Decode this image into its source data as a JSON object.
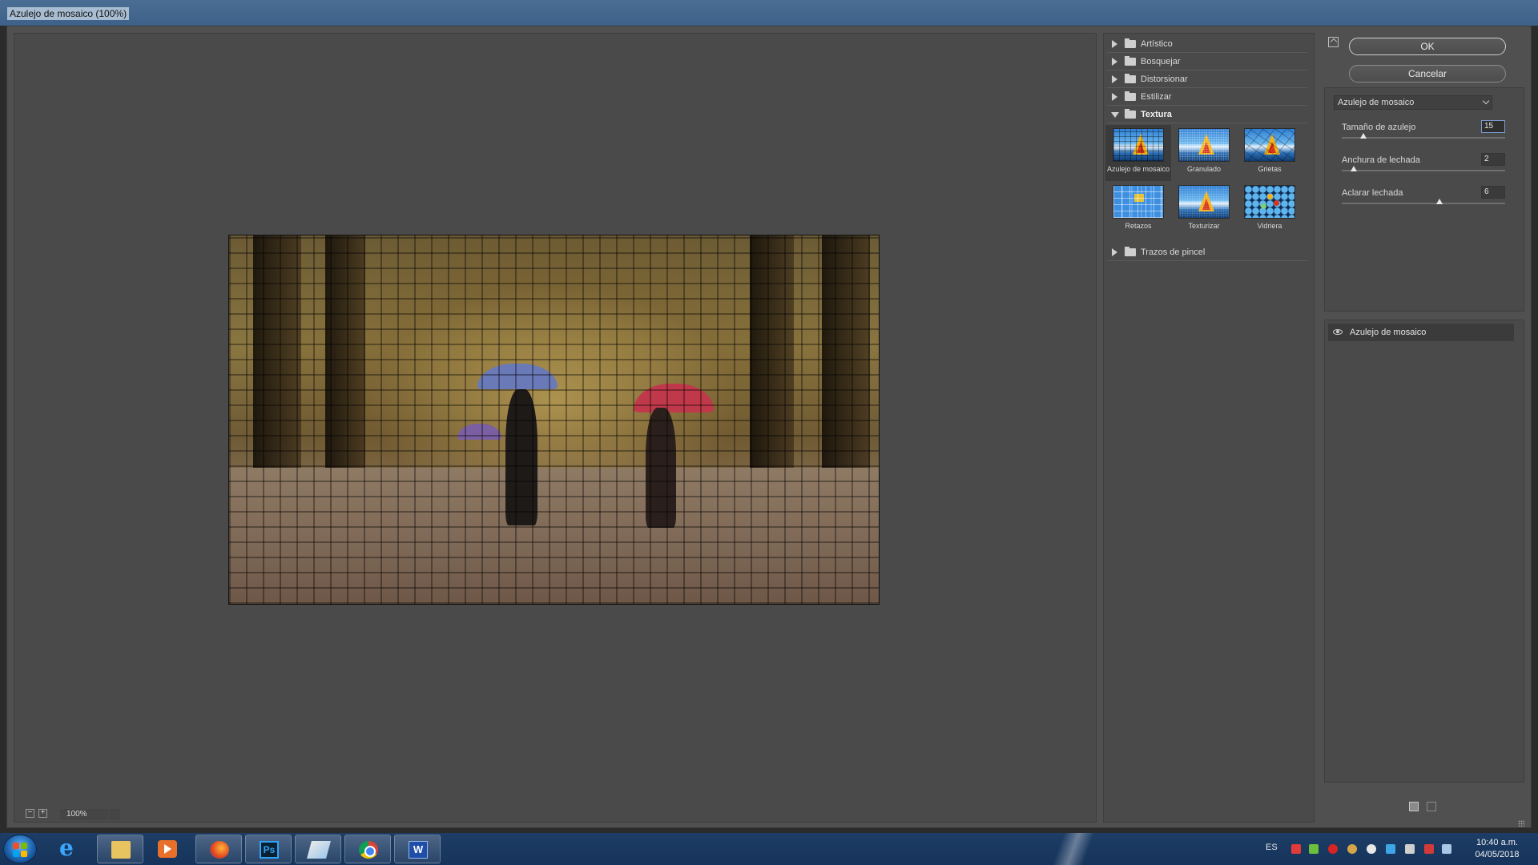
{
  "window": {
    "title": "Azulejo de mosaico (100%)"
  },
  "preview": {
    "zoom": "100%"
  },
  "gallery": {
    "categories": [
      {
        "label": "Artístico",
        "expanded": false
      },
      {
        "label": "Bosquejar",
        "expanded": false
      },
      {
        "label": "Distorsionar",
        "expanded": false
      },
      {
        "label": "Estilizar",
        "expanded": false
      },
      {
        "label": "Textura",
        "expanded": true
      },
      {
        "label": "Trazos de pincel",
        "expanded": false
      }
    ],
    "texture_filters": [
      {
        "label": "Azulejo de mosaico",
        "selected": true
      },
      {
        "label": "Granulado",
        "selected": false
      },
      {
        "label": "Grietas",
        "selected": false
      },
      {
        "label": "Retazos",
        "selected": false
      },
      {
        "label": "Texturizar",
        "selected": false
      },
      {
        "label": "Vidriera",
        "selected": false
      }
    ]
  },
  "settings": {
    "ok_label": "OK",
    "cancel_label": "Cancelar",
    "selected_filter": "Azulejo de mosaico",
    "params": [
      {
        "label": "Tamaño de azulejo",
        "value": "15",
        "min": 2,
        "max": 100
      },
      {
        "label": "Anchura de lechada",
        "value": "2",
        "min": 1,
        "max": 15
      },
      {
        "label": "Aclarar lechada",
        "value": "6",
        "min": 0,
        "max": 10
      }
    ]
  },
  "layers": {
    "items": [
      {
        "label": "Azulejo de mosaico",
        "visible": true
      }
    ]
  },
  "taskbar": {
    "apps": [
      "start-orb",
      "internet-explorer",
      "file-explorer",
      "media-player",
      "firefox",
      "photoshop",
      "pen-app",
      "chrome",
      "word"
    ],
    "language": "ES",
    "time": "10:40 a.m.",
    "date": "04/05/2018"
  },
  "colors": {
    "dialog_bg": "#505050",
    "panel_bg": "#4a4a4a",
    "taskbar": "#1d3d66",
    "selection": "#3b3b3b"
  }
}
